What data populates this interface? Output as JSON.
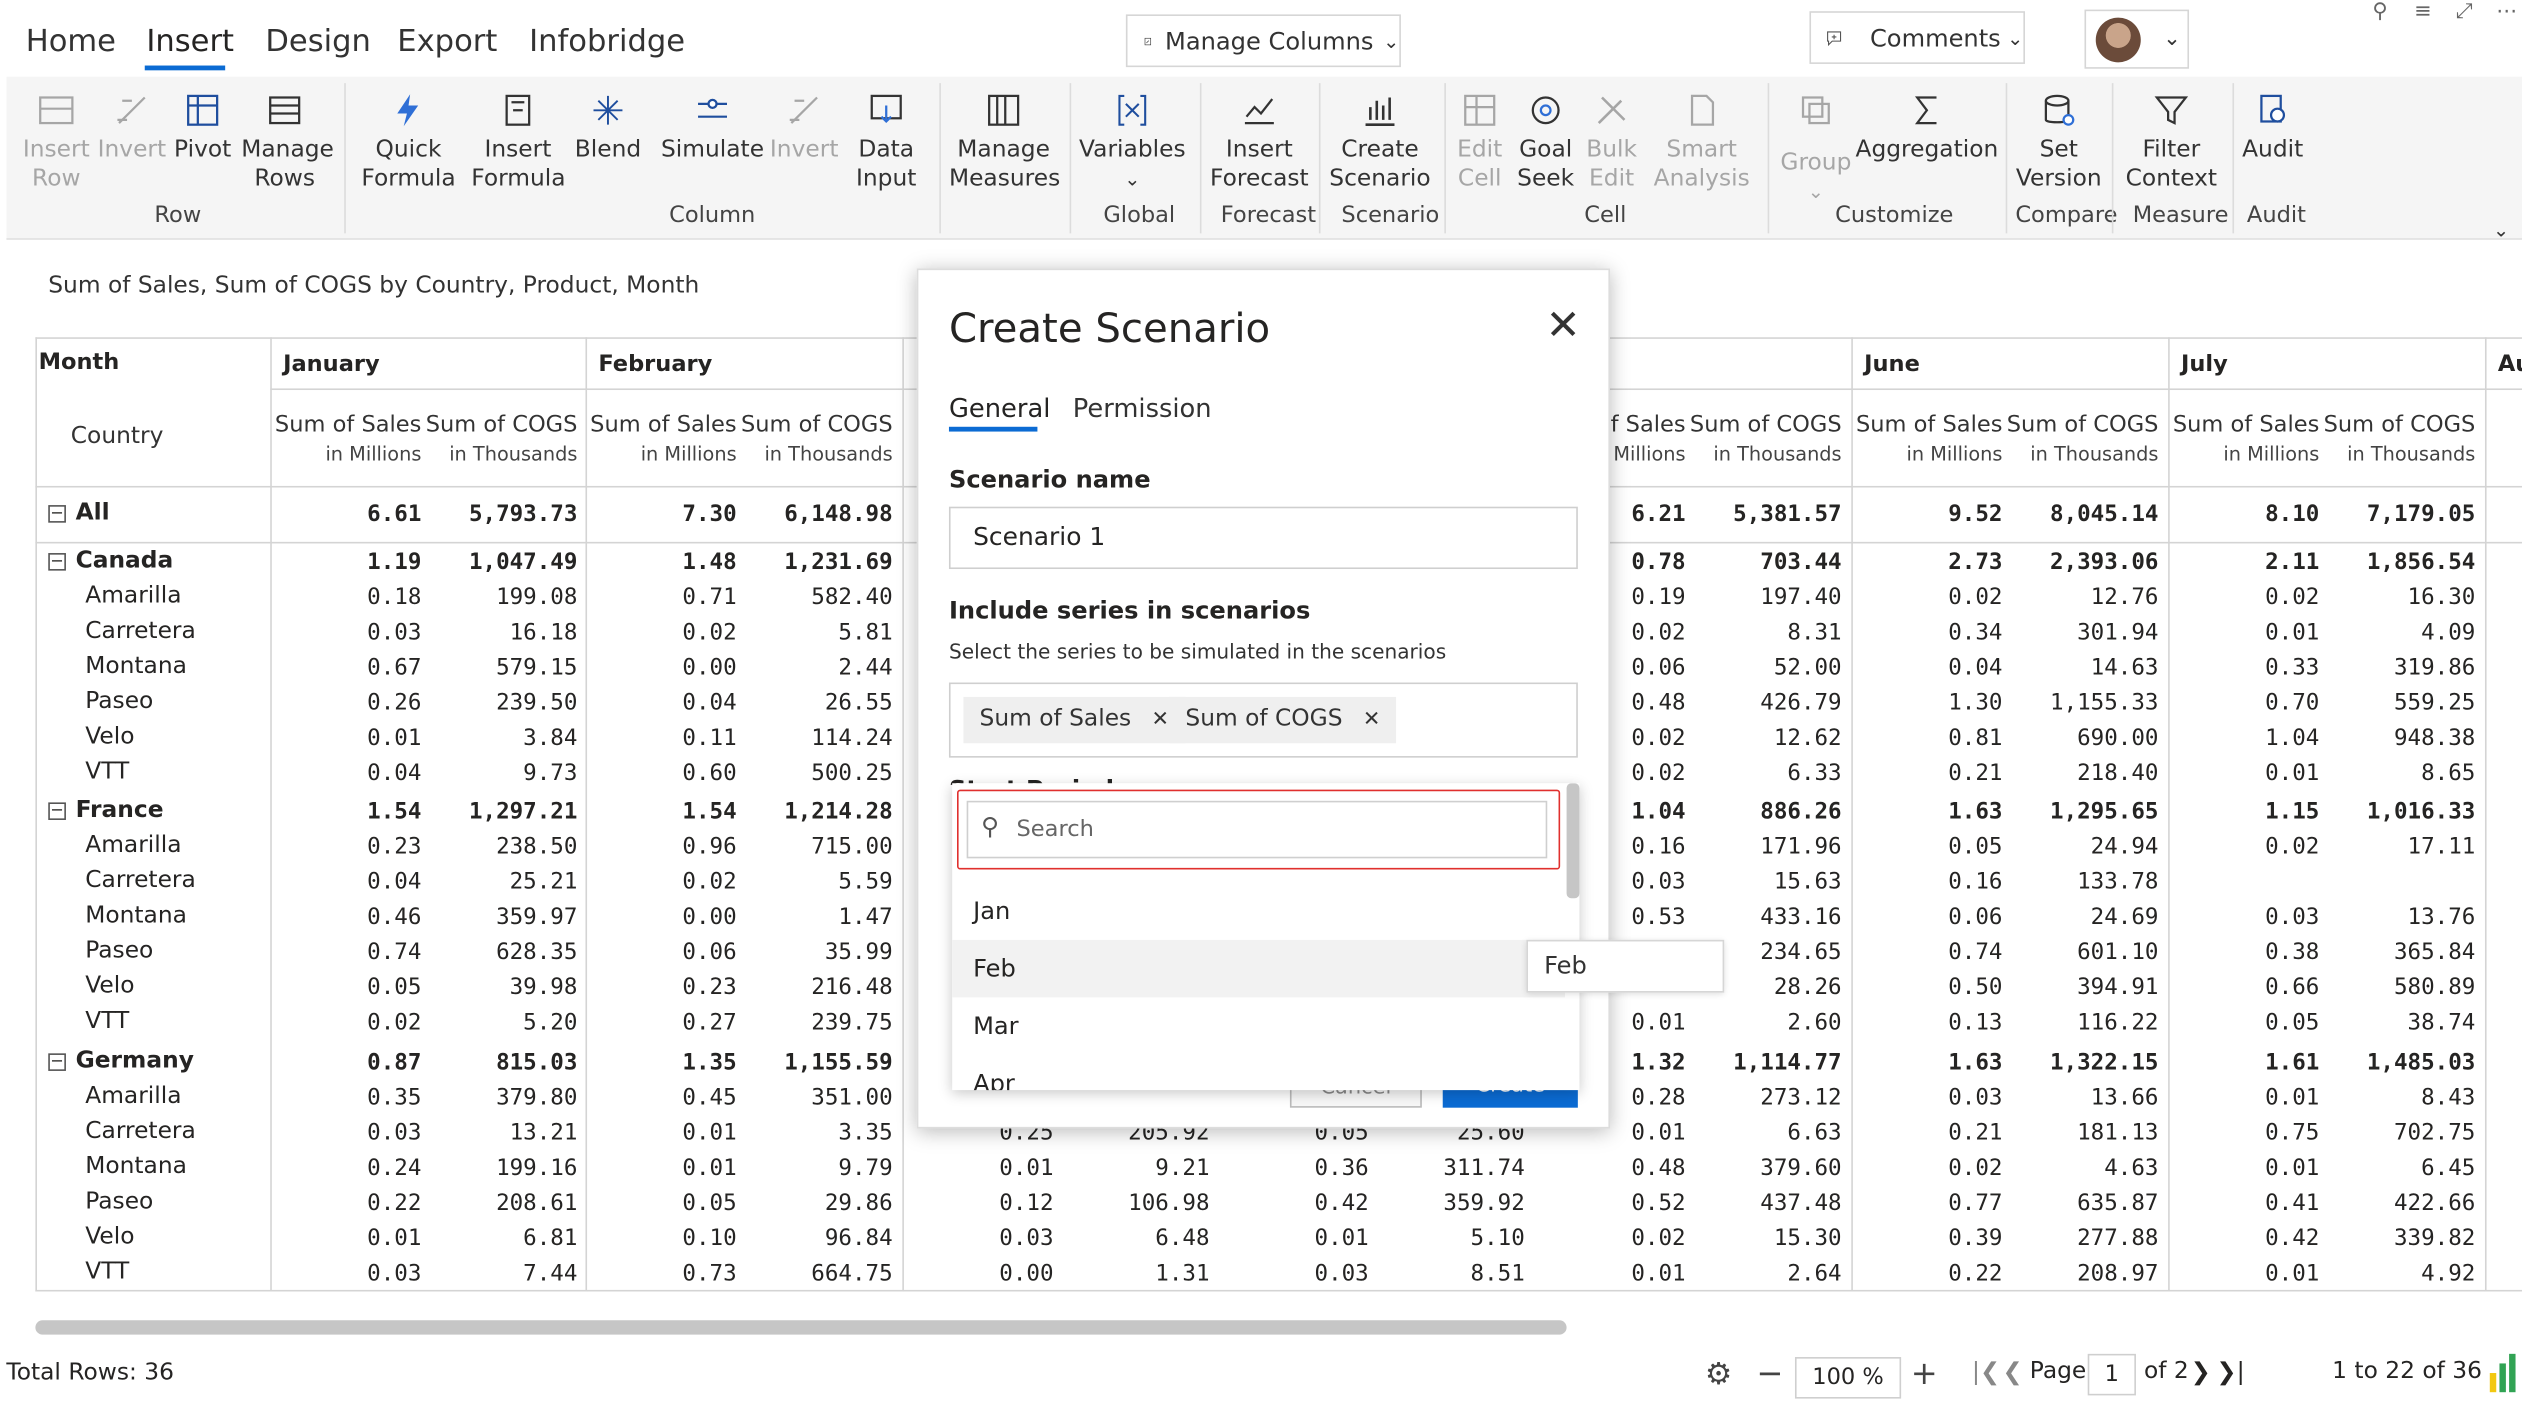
{
  "menu": {
    "tabs": [
      "Home",
      "Insert",
      "Design",
      "Export",
      "Infobridge"
    ],
    "active": "Insert"
  },
  "top": {
    "manage_columns": "Manage Columns",
    "comments": "Comments"
  },
  "ribbon": {
    "buttons": {
      "insert_row": "Insert Row",
      "invert1": "Invert",
      "pivot": "Pivot",
      "manage_rows": "Manage Rows",
      "quick_formula": "Quick Formula",
      "insert_formula": "Insert Formula",
      "blend": "Blend",
      "simulate": "Simulate",
      "invert2": "Invert",
      "data_input": "Data Input",
      "manage_measures": "Manage Measures",
      "variables": "Variables",
      "insert_forecast": "Insert Forecast",
      "create_scenario": "Create Scenario",
      "edit_cell": "Edit Cell",
      "goal_seek": "Goal Seek",
      "bulk_edit": "Bulk Edit",
      "smart_analysis": "Smart Analysis",
      "group": "Group",
      "aggregation": "Aggregation",
      "set_version": "Set Version",
      "filter_context": "Filter Context",
      "audit": "Audit"
    },
    "groups": {
      "row": "Row",
      "column": "Column",
      "global": "Global",
      "forecast": "Forecast",
      "scenario": "Scenario",
      "cell": "Cell",
      "customize": "Customize",
      "compare": "Compare",
      "measure": "Measure",
      "audit": "Audit"
    }
  },
  "subtitle": "Sum of Sales, Sum of COGS by Country, Product, Month",
  "table": {
    "month_label": "Month",
    "country_label": "Country",
    "months": [
      {
        "name": "January",
        "sub": [
          "Sum of Sales",
          "in Millions",
          "Sum of COGS",
          "in Thousands"
        ]
      },
      {
        "name": "February",
        "sub": [
          "Sum of Sales",
          "in Millions",
          "Sum of COGS",
          "in Thousands"
        ]
      },
      {
        "name": "",
        "sub": [
          "of Sales",
          "n Millions",
          "Sum of COGS",
          "in Thousands"
        ]
      },
      {
        "name": "June",
        "sub": [
          "Sum of Sales",
          "in Millions",
          "Sum of COGS",
          "in Thousands"
        ]
      },
      {
        "name": "July",
        "sub": [
          "Sum of Sales",
          "in Millions",
          "Sum of COGS",
          "in Thousands"
        ]
      },
      {
        "name": "Au",
        "sub": [
          "S",
          "",
          "",
          " "
        ]
      }
    ],
    "rows": [
      {
        "label": "All",
        "bold": true,
        "exp": true,
        "left": [
          "6.61",
          "5,793.73",
          "7.30",
          "6,148.98"
        ],
        "mid": [],
        "right": [
          "6.21",
          "5,381.57",
          "9.52",
          "8,045.14",
          "8.10",
          "7,179.05"
        ]
      },
      {
        "label": "Canada",
        "bold": true,
        "exp": true,
        "left": [
          "1.19",
          "1,047.49",
          "1.48",
          "1,231.69"
        ],
        "mid": [],
        "right": [
          "0.78",
          "703.44",
          "2.73",
          "2,393.06",
          "2.11",
          "1,856.54"
        ]
      },
      {
        "label": "Amarilla",
        "left": [
          "0.18",
          "199.08",
          "0.71",
          "582.40"
        ],
        "mid": [],
        "right": [
          "0.19",
          "197.40",
          "0.02",
          "12.76",
          "0.02",
          "16.30"
        ]
      },
      {
        "label": "Carretera",
        "left": [
          "0.03",
          "16.18",
          "0.02",
          "5.81"
        ],
        "mid": [],
        "right": [
          "0.02",
          "8.31",
          "0.34",
          "301.94",
          "0.01",
          "4.09"
        ]
      },
      {
        "label": "Montana",
        "left": [
          "0.67",
          "579.15",
          "0.00",
          "2.44"
        ],
        "mid": [],
        "right": [
          "0.06",
          "52.00",
          "0.04",
          "14.63",
          "0.33",
          "319.86"
        ]
      },
      {
        "label": "Paseo",
        "left": [
          "0.26",
          "239.50",
          "0.04",
          "26.55"
        ],
        "mid": [],
        "right": [
          "0.48",
          "426.79",
          "1.30",
          "1,155.33",
          "0.70",
          "559.25"
        ]
      },
      {
        "label": "Velo",
        "left": [
          "0.01",
          "3.84",
          "0.11",
          "114.24"
        ],
        "mid": [],
        "right": [
          "0.02",
          "12.62",
          "0.81",
          "690.00",
          "1.04",
          "948.38"
        ]
      },
      {
        "label": "VTT",
        "left": [
          "0.04",
          "9.73",
          "0.60",
          "500.25"
        ],
        "mid": [],
        "right": [
          "0.02",
          "6.33",
          "0.21",
          "218.40",
          "0.01",
          "8.65"
        ]
      },
      {
        "label": "France",
        "bold": true,
        "exp": true,
        "left": [
          "1.54",
          "1,297.21",
          "1.54",
          "1,214.28"
        ],
        "mid": [],
        "right": [
          "1.04",
          "886.26",
          "1.63",
          "1,295.65",
          "1.15",
          "1,016.33"
        ]
      },
      {
        "label": "Amarilla",
        "left": [
          "0.23",
          "238.50",
          "0.96",
          "715.00"
        ],
        "mid": [],
        "right": [
          "0.16",
          "171.96",
          "0.05",
          "24.94",
          "0.02",
          "17.11"
        ]
      },
      {
        "label": "Carretera",
        "left": [
          "0.04",
          "25.21",
          "0.02",
          "5.59"
        ],
        "mid": [],
        "right": [
          "0.03",
          "15.63",
          "0.16",
          "133.78",
          "",
          ""
        ]
      },
      {
        "label": "Montana",
        "left": [
          "0.46",
          "359.97",
          "0.00",
          "1.47"
        ],
        "mid": [],
        "right": [
          "0.53",
          "433.16",
          "0.06",
          "24.69",
          "0.03",
          "13.76"
        ]
      },
      {
        "label": "Paseo",
        "left": [
          "0.74",
          "628.35",
          "0.06",
          "35.99"
        ],
        "mid": [],
        "right": [
          "",
          "234.65",
          "0.74",
          "601.10",
          "0.38",
          "365.84"
        ]
      },
      {
        "label": "Velo",
        "left": [
          "0.05",
          "39.98",
          "0.23",
          "216.48"
        ],
        "mid": [],
        "right": [
          "",
          "28.26",
          "0.50",
          "394.91",
          "0.66",
          "580.89"
        ]
      },
      {
        "label": "VTT",
        "left": [
          "0.02",
          "5.20",
          "0.27",
          "239.75"
        ],
        "mid": [],
        "right": [
          "0.01",
          "2.60",
          "0.13",
          "116.22",
          "0.05",
          "38.74"
        ]
      },
      {
        "label": "Germany",
        "bold": true,
        "exp": true,
        "left": [
          "0.87",
          "815.03",
          "1.35",
          "1,155.59"
        ],
        "mid": [],
        "right": [
          "1.32",
          "1,114.77",
          "1.63",
          "1,322.15",
          "1.61",
          "1,485.03"
        ]
      },
      {
        "label": "Amarilla",
        "left": [
          "0.35",
          "379.80",
          "0.45",
          "351.00"
        ],
        "mid": [],
        "right": [
          "0.28",
          "273.12",
          "0.03",
          "13.66",
          "0.01",
          "8.43"
        ]
      },
      {
        "label": "Carretera",
        "left": [
          "0.03",
          "13.21",
          "0.01",
          "3.35"
        ],
        "mid": [
          "0.25",
          "205.92",
          "0.05",
          "25.60"
        ],
        "right": [
          "0.01",
          "6.63",
          "0.21",
          "181.13",
          "0.75",
          "702.75"
        ]
      },
      {
        "label": "Montana",
        "left": [
          "0.24",
          "199.16",
          "0.01",
          "9.79"
        ],
        "mid": [
          "0.01",
          "9.21",
          "0.36",
          "311.74"
        ],
        "right": [
          "0.48",
          "379.60",
          "0.02",
          "4.63",
          "0.01",
          "6.45"
        ]
      },
      {
        "label": "Paseo",
        "left": [
          "0.22",
          "208.61",
          "0.05",
          "29.86"
        ],
        "mid": [
          "0.12",
          "106.98",
          "0.42",
          "359.92"
        ],
        "right": [
          "0.52",
          "437.48",
          "0.77",
          "635.87",
          "0.41",
          "422.66"
        ]
      },
      {
        "label": "Velo",
        "left": [
          "0.01",
          "6.81",
          "0.10",
          "96.84"
        ],
        "mid": [
          "0.03",
          "6.48",
          "0.01",
          "5.10"
        ],
        "right": [
          "0.02",
          "15.30",
          "0.39",
          "277.88",
          "0.42",
          "339.82"
        ]
      },
      {
        "label": "VTT",
        "left": [
          "0.03",
          "7.44",
          "0.73",
          "664.75"
        ],
        "mid": [
          "0.00",
          "1.31",
          "0.03",
          "8.51"
        ],
        "right": [
          "0.01",
          "2.64",
          "0.22",
          "208.97",
          "0.01",
          "4.92"
        ]
      }
    ]
  },
  "dialog": {
    "title": "Create Scenario",
    "tabs": [
      "General",
      "Permission"
    ],
    "scenario_name_label": "Scenario name",
    "scenario_name_value": "Scenario 1",
    "series_label": "Include series in scenarios",
    "series_help": "Select the series to be simulated in the scenarios",
    "chips": [
      "Sum of Sales",
      "Sum of COGS"
    ],
    "start_period_partial": "Start Period",
    "cancel_partial": "Cancel",
    "create_partial": "Create"
  },
  "dropdown": {
    "search_placeholder": "Search",
    "options": [
      "Jan",
      "Feb",
      "Mar",
      "Apr"
    ],
    "tooltip": "Feb"
  },
  "status": {
    "total_rows": "Total Rows: 36",
    "zoom": "100 %",
    "page_label": "Page",
    "page_value": "1",
    "of_pages": "of 2",
    "range": "1 to 22 of 36"
  }
}
